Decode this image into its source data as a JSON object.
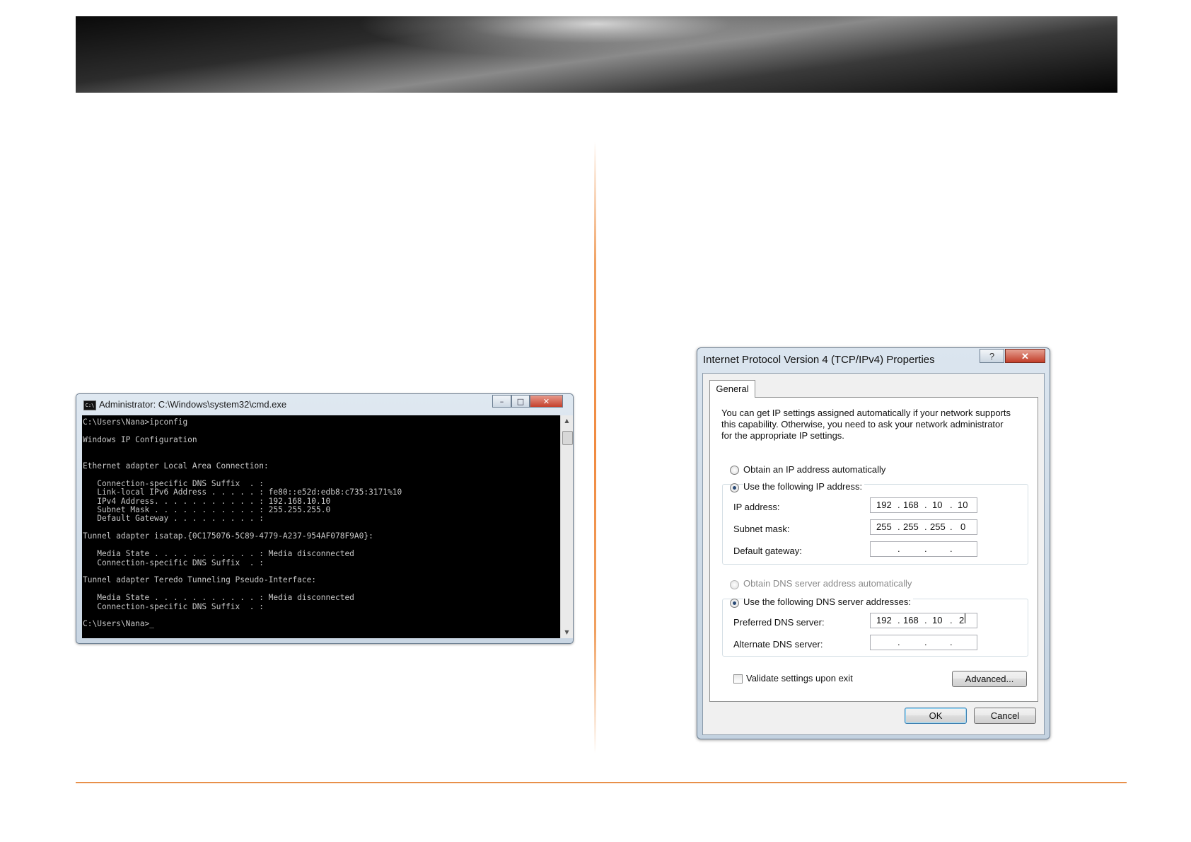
{
  "cmd": {
    "title": "Administrator: C:\\Windows\\system32\\cmd.exe",
    "icon_label": "C:\\",
    "buttons": {
      "minimize": "–",
      "maximize": "□",
      "close": "✕"
    },
    "scroll_up": "▲",
    "scroll_down": "▼",
    "output": "C:\\Users\\Nana>ipconfig\n\nWindows IP Configuration\n\n\nEthernet adapter Local Area Connection:\n\n   Connection-specific DNS Suffix  . :\n   Link-local IPv6 Address . . . . . : fe80::e52d:edb8:c735:3171%10\n   IPv4 Address. . . . . . . . . . . : 192.168.10.10\n   Subnet Mask . . . . . . . . . . . : 255.255.255.0\n   Default Gateway . . . . . . . . . :\n\nTunnel adapter isatap.{0C175076-5C89-4779-A237-954AF078F9A0}:\n\n   Media State . . . . . . . . . . . : Media disconnected\n   Connection-specific DNS Suffix  . :\n\nTunnel adapter Teredo Tunneling Pseudo-Interface:\n\n   Media State . . . . . . . . . . . : Media disconnected\n   Connection-specific DNS Suffix  . :\n\nC:\\Users\\Nana>_"
  },
  "dialog": {
    "title": "Internet Protocol Version 4 (TCP/IPv4) Properties",
    "help_button": "?",
    "close_button": "✕",
    "tab_general": "General",
    "description": [
      "You can get IP settings assigned automatically if your network supports",
      "this capability. Otherwise, you need to ask your network administrator",
      "for the appropriate IP settings."
    ],
    "obtain_ip_auto": "Obtain an IP address automatically",
    "use_following_ip": "Use the following IP address:",
    "ip_address_label": "IP address:",
    "ip_address": [
      "192",
      "168",
      "10",
      "10"
    ],
    "subnet_mask_label": "Subnet mask:",
    "subnet_mask": [
      "255",
      "255",
      "255",
      "0"
    ],
    "default_gateway_label": "Default gateway:",
    "default_gateway": [
      "",
      "",
      "",
      ""
    ],
    "obtain_dns_auto": "Obtain DNS server address automatically",
    "use_following_dns": "Use the following DNS server addresses:",
    "preferred_dns_label": "Preferred DNS server:",
    "preferred_dns": [
      "192",
      "168",
      "10",
      "2"
    ],
    "alternate_dns_label": "Alternate DNS server:",
    "alternate_dns": [
      "",
      "",
      "",
      ""
    ],
    "dot": ".",
    "validate_label": "Validate settings upon exit",
    "advanced_button": "Advanced...",
    "ok_button": "OK",
    "cancel_button": "Cancel"
  }
}
